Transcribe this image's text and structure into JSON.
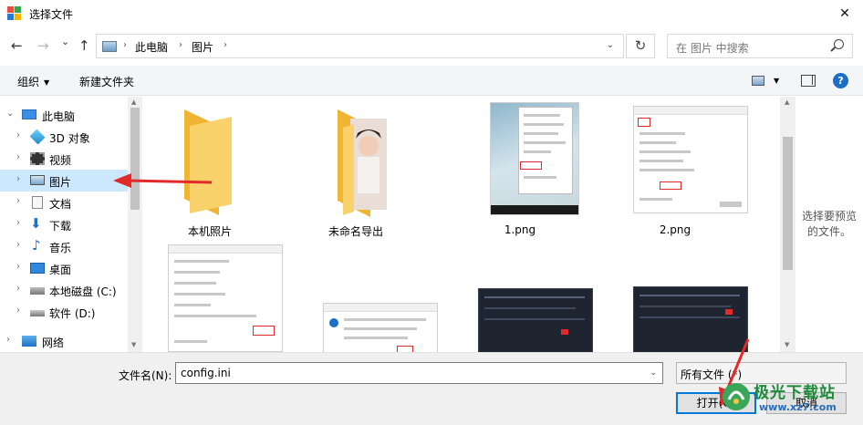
{
  "window": {
    "title": "选择文件",
    "close_glyph": "✕"
  },
  "nav": {
    "back_glyph": "←",
    "forward_glyph": "→",
    "down_glyph": "⌄",
    "up_glyph": "↑",
    "breadcrumb": [
      "此电脑",
      "图片"
    ],
    "breadcrumb_sep": "›",
    "dropdown_glyph": "⌄",
    "refresh_glyph": "↻",
    "search_placeholder": "在 图片 中搜索"
  },
  "toolbar": {
    "organize_label": "组织",
    "caret_glyph": "▼",
    "new_folder_label": "新建文件夹",
    "help_glyph": "?"
  },
  "tree": {
    "chev_right": "›",
    "chev_down": "⌄",
    "items": [
      {
        "label": "此电脑",
        "icon": "computer-icon",
        "expanded": true,
        "selected": false
      },
      {
        "label": "3D 对象",
        "icon": "3d-objects-icon",
        "expanded": false,
        "selected": false
      },
      {
        "label": "视频",
        "icon": "video-icon",
        "expanded": false,
        "selected": false
      },
      {
        "label": "图片",
        "icon": "pictures-icon",
        "expanded": false,
        "selected": true
      },
      {
        "label": "文档",
        "icon": "documents-icon",
        "expanded": false,
        "selected": false
      },
      {
        "label": "下载",
        "icon": "downloads-icon",
        "expanded": false,
        "selected": false
      },
      {
        "label": "音乐",
        "icon": "music-icon",
        "expanded": false,
        "selected": false
      },
      {
        "label": "桌面",
        "icon": "desktop-icon",
        "expanded": false,
        "selected": false
      },
      {
        "label": "本地磁盘 (C:)",
        "icon": "local-disk-icon",
        "expanded": false,
        "selected": false
      },
      {
        "label": "软件 (D:)",
        "icon": "drive-icon",
        "expanded": false,
        "selected": false
      },
      {
        "label": "网络",
        "icon": "network-icon",
        "expanded": false,
        "selected": false
      }
    ]
  },
  "files": [
    {
      "name": "本机照片",
      "kind": "folder"
    },
    {
      "name": "未命名导出",
      "kind": "folder-with-photo"
    },
    {
      "name": "1.png",
      "kind": "image-menu-screenshot"
    },
    {
      "name": "2.png",
      "kind": "image-settings-screenshot"
    },
    {
      "name": "",
      "kind": "image-settings-screenshot"
    },
    {
      "name": "",
      "kind": "image-dialog-screenshot"
    },
    {
      "name": "",
      "kind": "image-dark-screenshot"
    },
    {
      "name": "",
      "kind": "image-dark-screenshot"
    }
  ],
  "preview": {
    "text": "选择要预览的文件。"
  },
  "bottom": {
    "filename_label": "文件名(N):",
    "filename_value": "config.ini",
    "filetype_value": "所有文件 (*)",
    "open_label": "打开(O)",
    "cancel_label": "取消"
  },
  "watermark": {
    "name": "极光下载站",
    "url": "www.xz7.com"
  },
  "colors": {
    "accent": "#0078d7",
    "selection": "#cce8ff",
    "folder_yellow": "#f5c242",
    "annotation_red": "#e32a2a"
  }
}
